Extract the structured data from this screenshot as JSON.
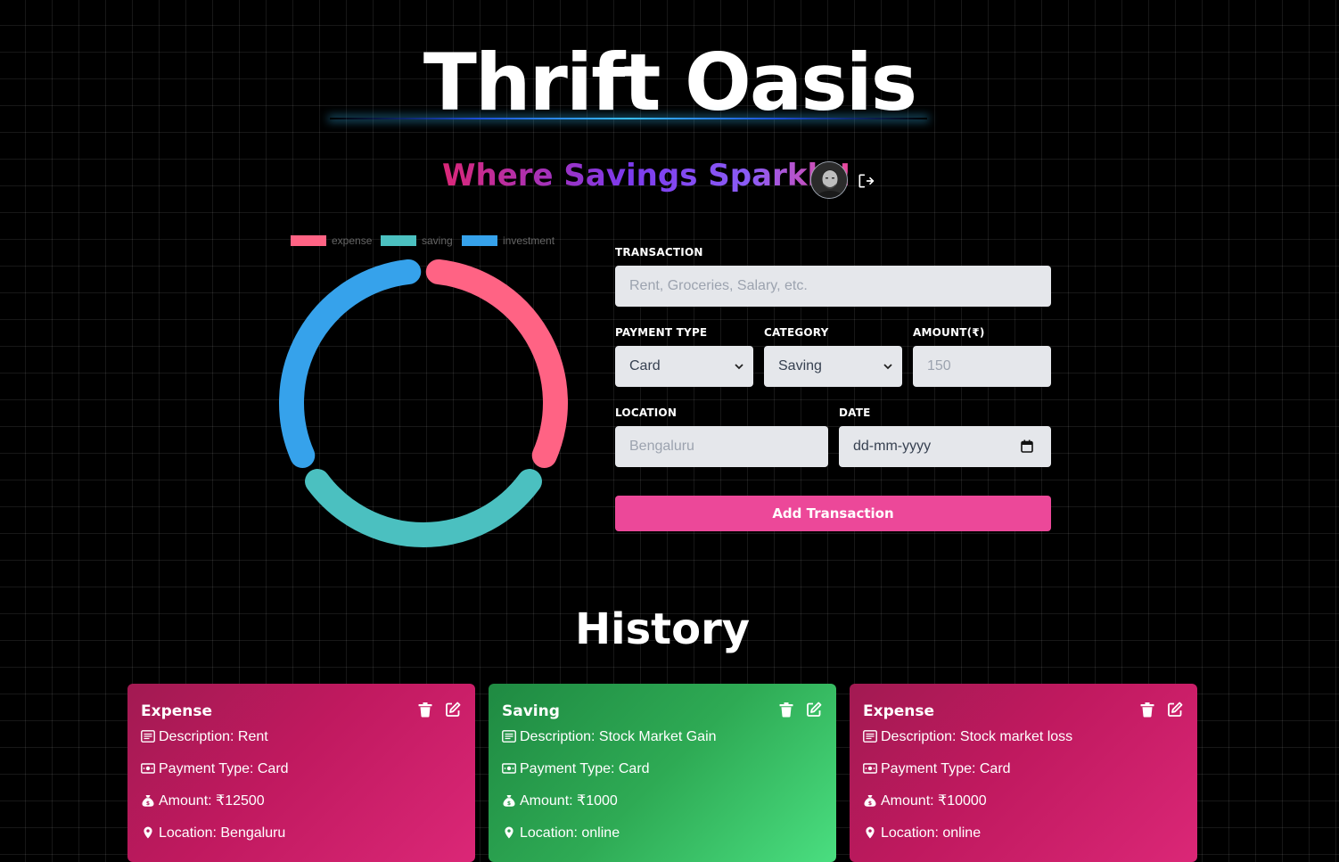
{
  "header": {
    "title": "Thrift Oasis",
    "subtitle": "Where Savings Sparkle!"
  },
  "chart_data": {
    "type": "pie",
    "categories": [
      "expense",
      "saving",
      "investment"
    ],
    "values": [
      1,
      1,
      1
    ],
    "colors": [
      "#ff6384",
      "#4bc0c0",
      "#36a2eb"
    ],
    "legend_position": "top"
  },
  "form": {
    "transaction_label": "TRANSACTION",
    "transaction_placeholder": "Rent, Groceries, Salary, etc.",
    "payment_type_label": "PAYMENT TYPE",
    "payment_type_value": "Card",
    "category_label": "CATEGORY",
    "category_value": "Saving",
    "amount_label": "AMOUNT(₹)",
    "amount_placeholder": "150",
    "location_label": "LOCATION",
    "location_placeholder": "Bengaluru",
    "date_label": "DATE",
    "date_placeholder": "dd-mm-yyyy",
    "submit_label": "Add Transaction",
    "submit_color": "#ec4899"
  },
  "history": {
    "title": "History",
    "cards": [
      {
        "category": "Expense",
        "description": "Description: Rent",
        "payment_type": "Payment Type: Card",
        "amount": "Amount: ₹12500",
        "location": "Location: Bengaluru"
      },
      {
        "category": "Saving",
        "description": "Description: Stock Market Gain",
        "payment_type": "Payment Type: Card",
        "amount": "Amount: ₹1000",
        "location": "Location: online"
      },
      {
        "category": "Expense",
        "description": "Description: Stock market loss",
        "payment_type": "Payment Type: Card",
        "amount": "Amount: ₹10000",
        "location": "Location: online"
      }
    ]
  }
}
